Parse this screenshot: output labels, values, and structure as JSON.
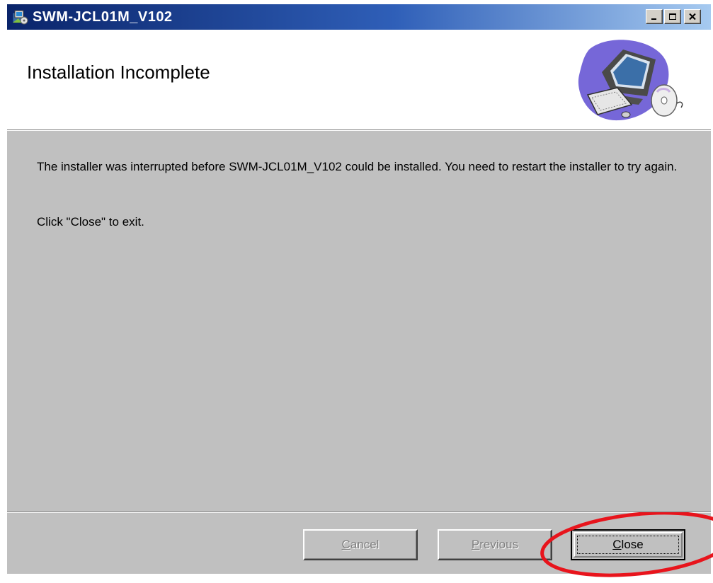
{
  "window": {
    "title": "SWM-JCL01M_V102"
  },
  "header": {
    "title": "Installation Incomplete"
  },
  "body": {
    "message": "The installer was interrupted before SWM-JCL01M_V102 could be installed. You need to restart the installer to try again.",
    "instruction": "Click \"Close\" to exit."
  },
  "buttons": {
    "cancel": {
      "label_prefix": "",
      "label_mnemonic": "C",
      "label_rest": "ancel",
      "enabled": false
    },
    "previous": {
      "label_prefix": "",
      "label_mnemonic": "P",
      "label_rest": "revious",
      "enabled": false
    },
    "close": {
      "label_prefix": "",
      "label_mnemonic": "C",
      "label_rest": "lose",
      "enabled": true
    }
  },
  "colors": {
    "titlebar_start": "#0a246a",
    "titlebar_end": "#a6caf0",
    "dialog_face": "#c0c0c0",
    "annotation": "#e8141c"
  },
  "icons": {
    "app": "installer-app-icon",
    "minimize": "minimize-icon",
    "maximize": "maximize-icon",
    "close": "close-icon",
    "header_art": "computer-with-disc-icon"
  }
}
